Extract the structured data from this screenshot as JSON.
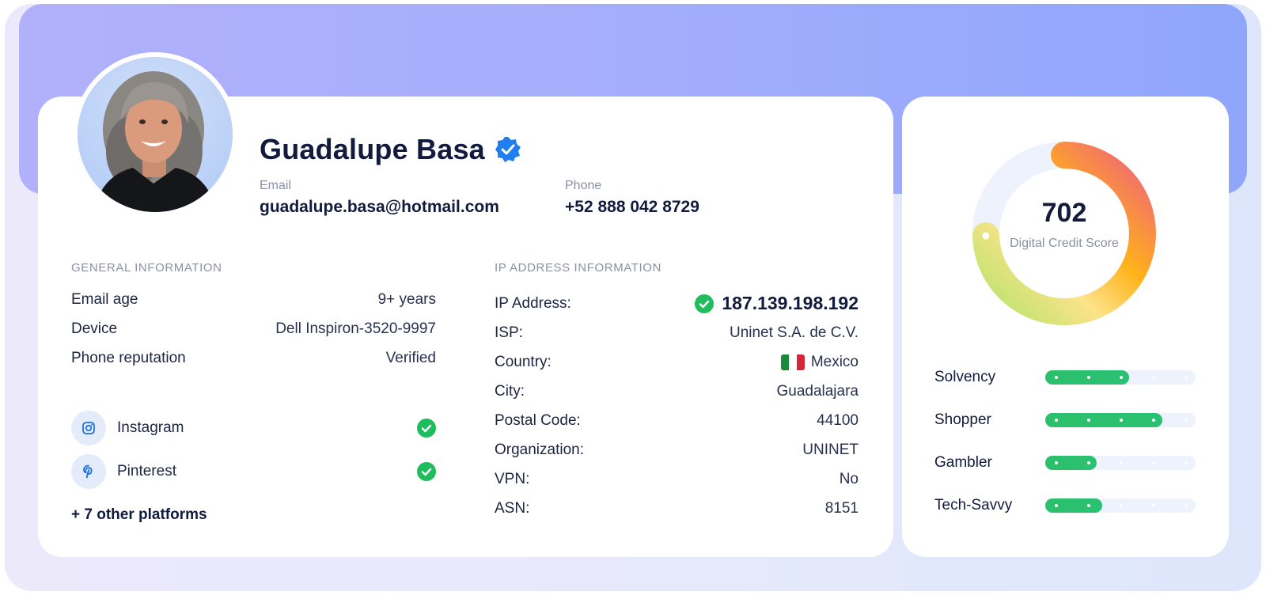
{
  "profile": {
    "name": "Guadalupe Basa",
    "email_label": "Email",
    "email": "guadalupe.basa@hotmail.com",
    "phone_label": "Phone",
    "phone": "+52 888 042 8729"
  },
  "general": {
    "title": "GENERAL INFORMATION",
    "rows": [
      {
        "label": "Email age",
        "value": "9+ years"
      },
      {
        "label": "Device",
        "value": "Dell Inspiron-3520-9997"
      },
      {
        "label": "Phone reputation",
        "value": "Verified"
      }
    ],
    "socials": [
      {
        "label": "Instagram",
        "icon": "instagram-icon",
        "verified": true
      },
      {
        "label": "Pinterest",
        "icon": "pinterest-icon",
        "verified": true
      }
    ],
    "others": "+ 7 other platforms"
  },
  "ip": {
    "title": "IP ADDRESS INFORMATION",
    "rows": [
      {
        "label": "IP Address:",
        "value": "187.139.198.192"
      },
      {
        "label": "ISP:",
        "value": "Uninet S.A. de C.V."
      },
      {
        "label": "Country:",
        "value": "Mexico"
      },
      {
        "label": "City:",
        "value": "Guadalajara"
      },
      {
        "label": "Postal Code:",
        "value": "44100"
      },
      {
        "label": "Organization:",
        "value": "UNINET"
      },
      {
        "label": "VPN:",
        "value": "No"
      },
      {
        "label": "ASN:",
        "value": "8151"
      }
    ]
  },
  "score": {
    "value": "702",
    "label": "Digital Credit Score",
    "traits": [
      {
        "label": "Solvency",
        "level": 0.56
      },
      {
        "label": "Shopper",
        "level": 0.78
      },
      {
        "label": "Gambler",
        "level": 0.34
      },
      {
        "label": "Tech-Savvy",
        "level": 0.38
      }
    ]
  },
  "colors": {
    "accent": "#1f7ef0",
    "success": "#1fbd5d",
    "bar_fill": "#2cc06c",
    "gauge_start": "#b6e36b",
    "gauge_mid": "#ffb21a",
    "gauge_end": "#f0637a"
  }
}
